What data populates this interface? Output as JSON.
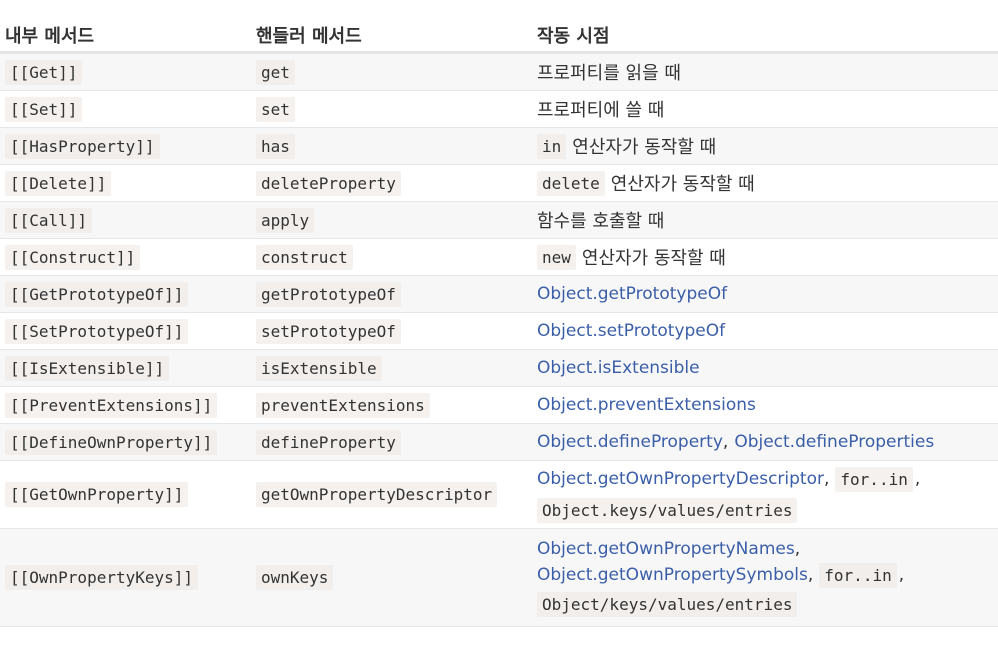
{
  "header": {
    "col1": "내부 메서드",
    "col2": "핸들러 메서드",
    "col3": "작동 시점"
  },
  "rows": [
    {
      "internal": "[[Get]]",
      "handler": "get",
      "trigger_text": "프로퍼티를 읽을 때"
    },
    {
      "internal": "[[Set]]",
      "handler": "set",
      "trigger_text": "프로퍼티에 쓸 때"
    },
    {
      "internal": "[[HasProperty]]",
      "handler": "has",
      "trigger_code": "in",
      "trigger_text": "연산자가 동작할 때"
    },
    {
      "internal": "[[Delete]]",
      "handler": "deleteProperty",
      "trigger_code": "delete",
      "trigger_text": "연산자가 동작할 때"
    },
    {
      "internal": "[[Call]]",
      "handler": "apply",
      "trigger_text": "함수를 호출할 때"
    },
    {
      "internal": "[[Construct]]",
      "handler": "construct",
      "trigger_code": "new",
      "trigger_text": "연산자가 동작할 때"
    },
    {
      "internal": "[[GetPrototypeOf]]",
      "handler": "getPrototypeOf",
      "trigger_link": "Object.getPrototypeOf"
    },
    {
      "internal": "[[SetPrototypeOf]]",
      "handler": "setPrototypeOf",
      "trigger_link": "Object.setPrototypeOf"
    },
    {
      "internal": "[[IsExtensible]]",
      "handler": "isExtensible",
      "trigger_link": "Object.isExtensible"
    },
    {
      "internal": "[[PreventExtensions]]",
      "handler": "preventExtensions",
      "trigger_link": "Object.preventExtensions"
    },
    {
      "internal": "[[DefineOwnProperty]]",
      "handler": "defineProperty",
      "trigger_link": "Object.defineProperty",
      "trigger_sep": ",",
      "trigger_link2": "Object.defineProperties"
    },
    {
      "internal": "[[GetOwnProperty]]",
      "handler": "getOwnPropertyDescriptor",
      "trigger_link": "Object.getOwnPropertyDescriptor",
      "trigger_sep": ",",
      "trigger_code": "for..in",
      "trigger_sep2": ",",
      "trigger_code2": "Object.keys/values/entries"
    },
    {
      "internal": "[[OwnPropertyKeys]]",
      "handler": "ownKeys",
      "trigger_link": "Object.getOwnPropertyNames",
      "trigger_sep": ",",
      "trigger_link2": "Object.getOwnPropertySymbols",
      "trigger_sep2": ",",
      "trigger_code": "for..in",
      "trigger_sep3": ",",
      "trigger_code2": "Object/keys/values/entries"
    }
  ]
}
